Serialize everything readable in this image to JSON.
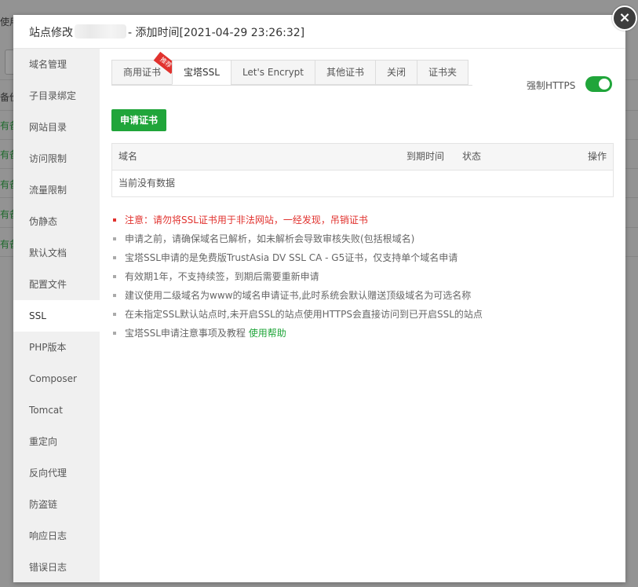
{
  "background": {
    "fragments": [
      "使用",
      "备份",
      "有备",
      "有备",
      "有备",
      "有备",
      "有备"
    ]
  },
  "dialog": {
    "title_prefix": "站点修改",
    "title_suffix": "- 添加时间[2021-04-29 23:26:32]",
    "close_icon": "×"
  },
  "sidebar": {
    "items": [
      {
        "label": "域名管理"
      },
      {
        "label": "子目录绑定"
      },
      {
        "label": "网站目录"
      },
      {
        "label": "访问限制"
      },
      {
        "label": "流量限制"
      },
      {
        "label": "伪静态"
      },
      {
        "label": "默认文档"
      },
      {
        "label": "配置文件"
      },
      {
        "label": "SSL"
      },
      {
        "label": "PHP版本"
      },
      {
        "label": "Composer"
      },
      {
        "label": "Tomcat"
      },
      {
        "label": "重定向"
      },
      {
        "label": "反向代理"
      },
      {
        "label": "防盗链"
      },
      {
        "label": "响应日志"
      },
      {
        "label": "错误日志"
      }
    ],
    "active_index": 8
  },
  "tabs": [
    {
      "label": "商用证书",
      "ribbon": "推荐"
    },
    {
      "label": "宝塔SSL"
    },
    {
      "label": "Let's Encrypt"
    },
    {
      "label": "其他证书"
    },
    {
      "label": "关闭"
    },
    {
      "label": "证书夹"
    }
  ],
  "active_tab": 1,
  "force_https": {
    "label": "强制HTTPS",
    "enabled": true
  },
  "apply_button": "申请证书",
  "table": {
    "columns": [
      "域名",
      "到期时间",
      "状态",
      "操作"
    ],
    "empty_text": "当前没有数据"
  },
  "notes": [
    "注意：请勿将SSL证书用于非法网站，一经发现，吊销证书",
    "申请之前，请确保域名已解析，如未解析会导致审核失败(包括根域名)",
    "宝塔SSL申请的是免费版TrustAsia DV SSL CA - G5证书，仅支持单个域名申请",
    "有效期1年，不支持续签，到期后需要重新申请",
    "建议使用二级域名为www的域名申请证书,此时系统会默认赠送顶级域名为可选名称",
    "在未指定SSL默认站点时,未开启SSL的站点使用HTTPS会直接访问到已开启SSL的站点",
    "宝塔SSL申请注意事项及教程"
  ],
  "help_link": "使用帮助",
  "colors": {
    "accent": "#20a53a",
    "warning": "#e1322e"
  }
}
